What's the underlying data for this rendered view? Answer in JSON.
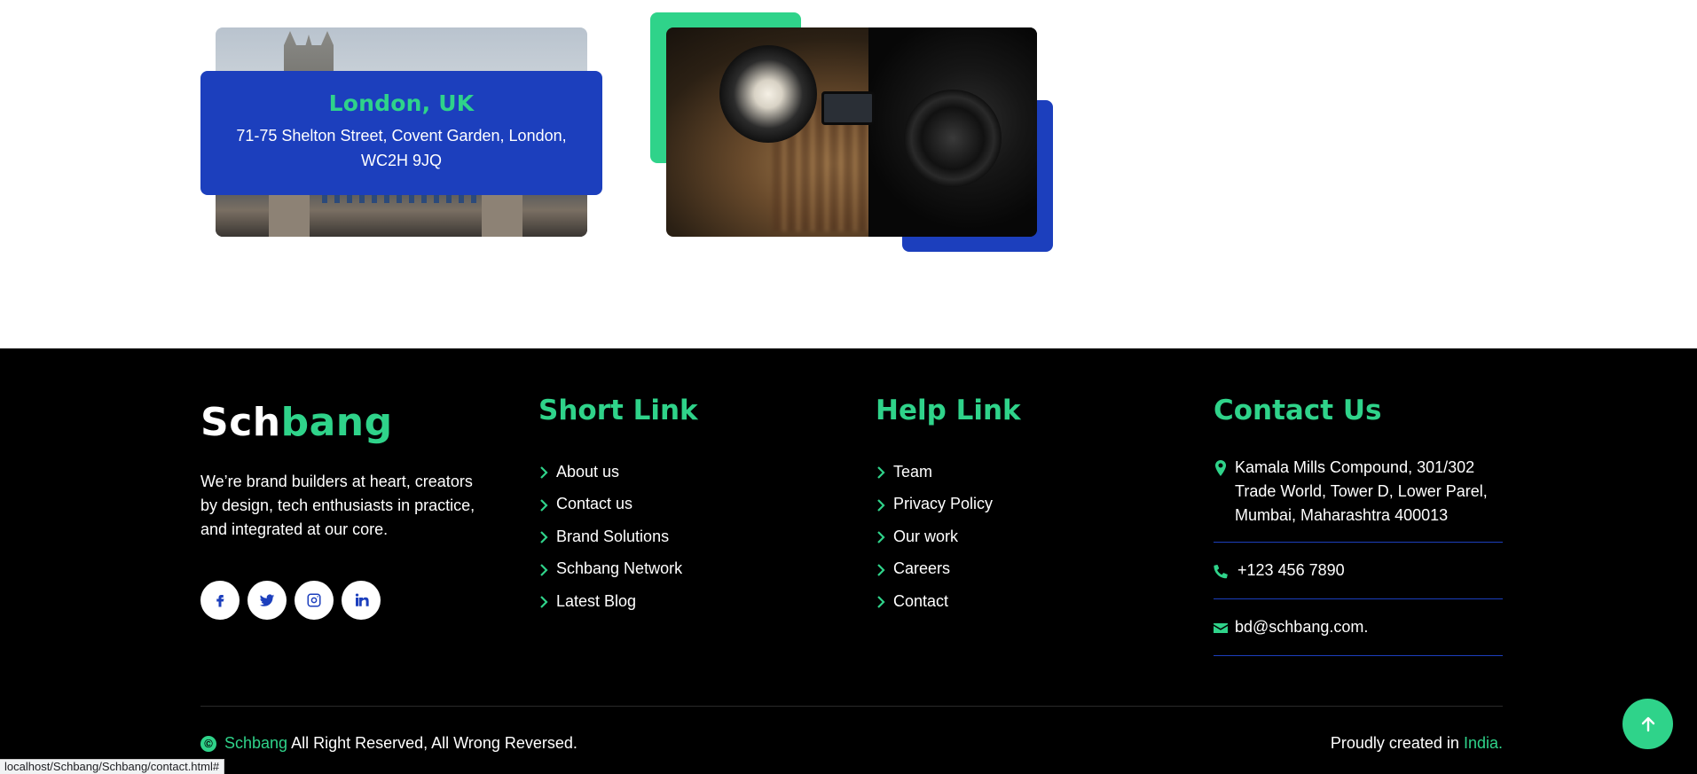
{
  "location_card": {
    "title": "London, UK",
    "address": "71-75 Shelton Street, Covent Garden, London, WC2H 9JQ"
  },
  "footer": {
    "brand": {
      "part1": "Sch",
      "part2": "bang"
    },
    "about": "We’re brand builders at heart, creators by design, tech enthusiasts in practice, and integrated at our core.",
    "socials": [
      "facebook-icon",
      "twitter-icon",
      "instagram-icon",
      "linkedin-icon"
    ],
    "short_link": {
      "title": "Short Link",
      "items": [
        "About us",
        "Contact us",
        "Brand Solutions",
        "Schbang Network",
        "Latest Blog"
      ]
    },
    "help_link": {
      "title": "Help Link",
      "items": [
        "Team",
        "Privacy Policy",
        "Our work",
        "Careers",
        "Contact"
      ]
    },
    "contact": {
      "title": "Contact Us",
      "address": "Kamala Mills Compound, 301/302 Trade World, Tower D, Lower Parel, Mumbai, Maharashtra 400013",
      "phone": "+123 456 7890",
      "email": "bd@schbang.com."
    },
    "copyright": {
      "brand": "Schbang",
      "text": " All Right Reserved, All Wrong Reversed."
    },
    "credit": {
      "text": "Proudly created in ",
      "country": "India."
    }
  },
  "status_bar": {
    "url": "localhost/Schbang/Schbang/contact.html#"
  },
  "colors": {
    "accent_green": "#2fd38a",
    "accent_blue": "#1c3fbd",
    "footer_bg": "#000000"
  }
}
